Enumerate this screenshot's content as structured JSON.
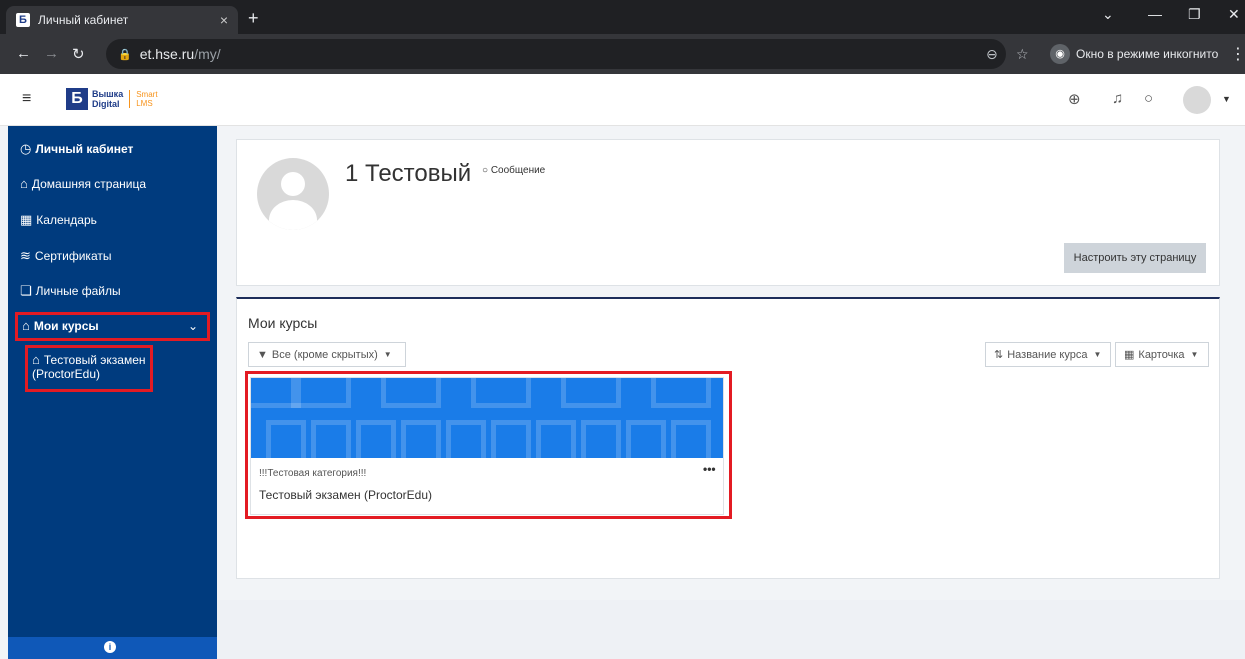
{
  "browser": {
    "tab_title": "Личный кабинет",
    "tab_close": "×",
    "new_tab": "+",
    "url_host": "et.hse.ru",
    "url_path": "/my/",
    "incognito_label": "Окно в режиме инкогнито"
  },
  "header": {
    "logo_mark": "Б",
    "brand_line1": "Вышка",
    "brand_line2": "Digital",
    "smart_line1": "Smart",
    "smart_line2": "LMS"
  },
  "sidebar": {
    "items": [
      {
        "label": "Личный кабинет",
        "icon": "dashboard-icon"
      },
      {
        "label": "Домашняя страница",
        "icon": "home-icon"
      },
      {
        "label": "Календарь",
        "icon": "calendar-icon"
      },
      {
        "label": "Сертификаты",
        "icon": "certificate-icon"
      },
      {
        "label": "Личные файлы",
        "icon": "files-icon"
      },
      {
        "label": "Мои курсы",
        "icon": "graduation-cap-icon"
      }
    ],
    "course_line1": "Тестовый экзамен",
    "course_line2": "(ProctorEdu)"
  },
  "profile": {
    "name": "1 Тестовый",
    "message_label": "Сообщение",
    "customize_label": "Настроить эту страницу"
  },
  "courses": {
    "title": "Мои курсы",
    "filter_label": "Все (кроме скрытых)",
    "sort_label": "Название курса",
    "view_label": "Карточка",
    "course_category": "!!!Тестовая категория!!!",
    "course_name": "Тестовый экзамен (ProctorEdu)",
    "course_menu": "•••"
  },
  "colors": {
    "sidebar_bg": "#003b7e",
    "highlight_red": "#e31b23",
    "course_image": "#1a7ce8"
  }
}
